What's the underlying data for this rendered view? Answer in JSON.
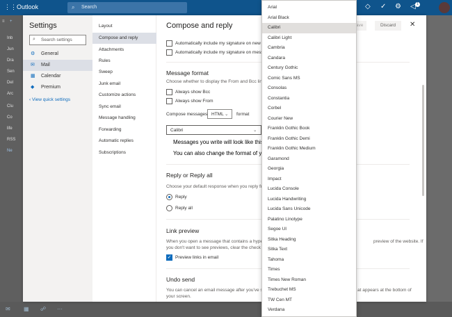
{
  "topbar": {
    "brand": "Outlook",
    "search_placeholder": "Search",
    "badge": "1"
  },
  "bgnav": {
    "items": [
      "Inb",
      "Jun",
      "Dra",
      "Sen",
      "Del",
      "Arc",
      "Clu",
      "Co",
      "life",
      "RSS",
      "Ne"
    ]
  },
  "settings": {
    "title": "Settings",
    "search_placeholder": "Search settings",
    "nav": [
      {
        "label": "General",
        "icon": "gear-icon"
      },
      {
        "label": "Mail",
        "icon": "mail-icon"
      },
      {
        "label": "Calendar",
        "icon": "calendar-icon"
      },
      {
        "label": "Premium",
        "icon": "diamond-icon"
      }
    ],
    "quick": "View quick settings"
  },
  "subnav": [
    "Layout",
    "Compose and reply",
    "Attachments",
    "Rules",
    "Sweep",
    "Junk email",
    "Customize actions",
    "Sync email",
    "Message handling",
    "Forwarding",
    "Automatic replies",
    "Subscriptions"
  ],
  "content": {
    "title": "Compose and reply",
    "save": "Save",
    "discard": "Discard",
    "sig1": "Automatically include my signature on new e",
    "sig2": "Automatically include my signature on messa",
    "msgformat_title": "Message format",
    "msgformat_desc": "Choose whether to display the From and Bcc line",
    "bcc": "Always show Bcc",
    "from": "Always show From",
    "compose_in": "Compose messages in",
    "compose_format": "HTML",
    "format_suffix": "format",
    "font_value": "Calibri",
    "preview1": "Messages you write will look like this by",
    "preview2": "You can also change the format of your",
    "reply_title": "Reply or Reply all",
    "reply_desc": "Choose your default response when you reply fro",
    "reply": "Reply",
    "reply_all": "Reply all",
    "link_title": "Link preview",
    "link_desc1": "When you open a message that contains a hyper",
    "link_desc1b": "preview of the website. If",
    "link_desc2": "you don't want to see previews, clear the check b",
    "link_chk": "Preview links in email",
    "undo_title": "Undo send",
    "undo_desc1": "You can cancel an email message after you've sel",
    "undo_desc1b": "at appears at the bottom of",
    "undo_desc2": "your screen."
  },
  "fonts": [
    "Arial",
    "Arial Black",
    "Calibri",
    "Calibri Light",
    "Cambria",
    "Candara",
    "Century Gothic",
    "Comic Sans MS",
    "Consolas",
    "Constantia",
    "Corbel",
    "Courier New",
    "Franklin Gothic Book",
    "Franklin Gothic Demi",
    "Franklin Gothic Medium",
    "Garamond",
    "Georgia",
    "Impact",
    "Lucida Console",
    "Lucida Handwriting",
    "Lucida Sans Unicode",
    "Palatino Linotype",
    "Segoe UI",
    "Sitka Heading",
    "Sitka Text",
    "Tahoma",
    "Times",
    "Times New Roman",
    "Trebuchet MS",
    "TW Cen MT",
    "Verdana"
  ],
  "selected_font": "Calibri"
}
